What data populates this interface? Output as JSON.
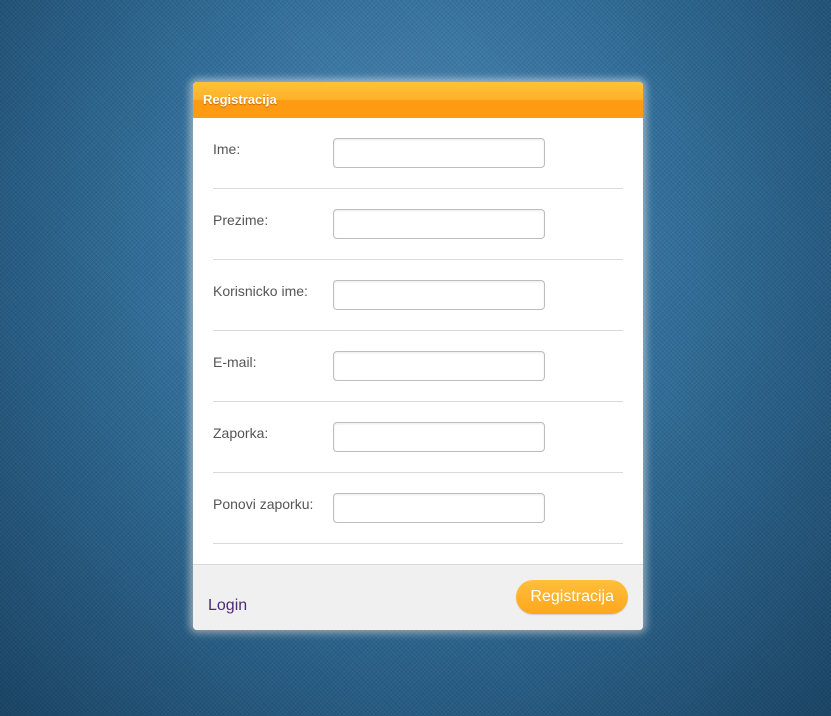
{
  "form": {
    "title": "Registracija",
    "fields": [
      {
        "label": "Ime:",
        "value": "",
        "placeholder": ""
      },
      {
        "label": "Prezime:",
        "value": "",
        "placeholder": ""
      },
      {
        "label": "Korisnicko ime:",
        "value": "",
        "placeholder": ""
      },
      {
        "label": "E-mail:",
        "value": "",
        "placeholder": ""
      },
      {
        "label": "Zaporka:",
        "value": "",
        "placeholder": ""
      },
      {
        "label": "Ponovi zaporku:",
        "value": "",
        "placeholder": ""
      }
    ]
  },
  "footer": {
    "login_link": "Login",
    "submit_label": "Registracija"
  },
  "colors": {
    "header_accent": "#ff9a12",
    "button_accent": "#ffa61e",
    "link_color": "#4b2a78",
    "background": "#2f6d98"
  }
}
